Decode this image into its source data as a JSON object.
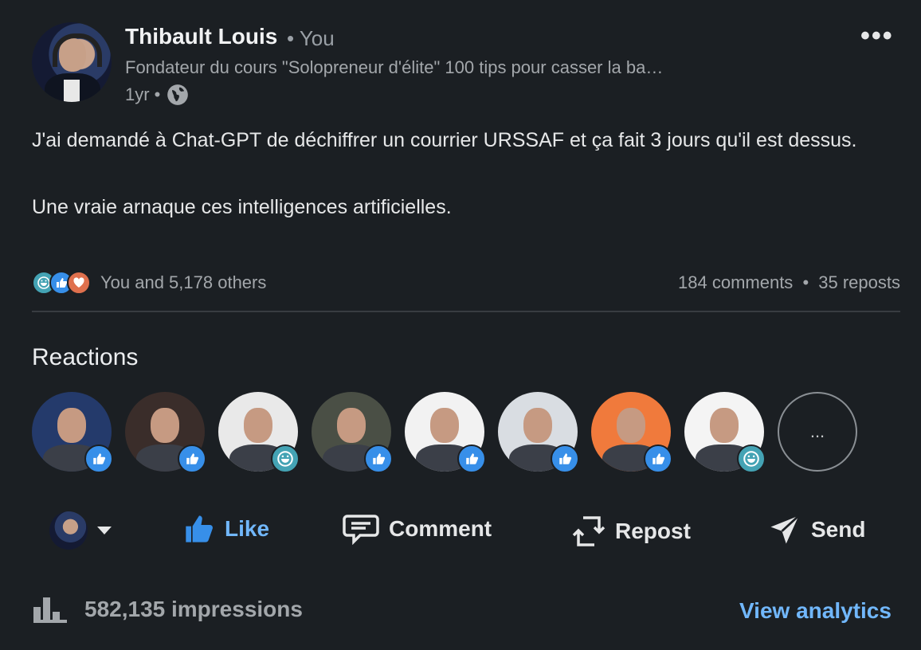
{
  "author": {
    "name": "Thibault Louis",
    "relation": "• You",
    "headline": "Fondateur du cours \"Solopreneur d'élite\" 100 tips pour casser la ba…",
    "time": "1yr •"
  },
  "post": {
    "line1": "J'ai demandé à Chat-GPT de déchiffrer un courrier URSSAF et ça fait 3 jours qu'il est dessus.",
    "line2": "Une vraie arnaque ces intelligences artificielles."
  },
  "social": {
    "reactions_text": "You and 5,178 others",
    "comments_text": "184 comments",
    "separator": "•",
    "reposts_text": "35 reposts"
  },
  "reactions_section": {
    "title": "Reactions",
    "more_label": "...",
    "people": [
      {
        "reaction": "like",
        "bg": "#243a6b"
      },
      {
        "reaction": "like",
        "bg": "#3a2d2a"
      },
      {
        "reaction": "funny",
        "bg": "#e9e9e9"
      },
      {
        "reaction": "like",
        "bg": "#4a4f45"
      },
      {
        "reaction": "like",
        "bg": "#f2f2f2"
      },
      {
        "reaction": "like",
        "bg": "#d9dde2"
      },
      {
        "reaction": "like",
        "bg": "#f07a3c"
      },
      {
        "reaction": "funny",
        "bg": "#f4f4f4"
      }
    ]
  },
  "actions": {
    "like": "Like",
    "comment": "Comment",
    "repost": "Repost",
    "send": "Send"
  },
  "footer": {
    "impressions": "582,135 impressions",
    "analytics": "View analytics"
  },
  "colors": {
    "background": "#1b1f23",
    "accent": "#71b7fb",
    "like_badge": "#378fe9",
    "funny_badge": "#44a3b4",
    "love_badge": "#df704d"
  }
}
